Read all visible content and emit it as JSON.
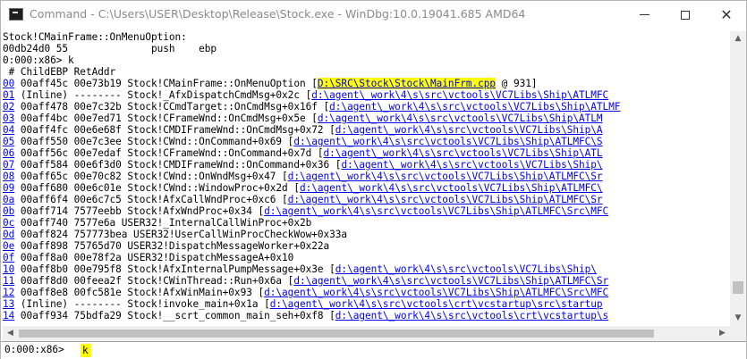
{
  "window": {
    "title": "Command - C:\\Users\\USER\\Desktop\\Release\\Stock.exe - WinDbg:10.0.19041.685 AMD64",
    "minimize_icon": "minimize-icon",
    "maximize_icon": "maximize-icon",
    "close_glyph": "✕"
  },
  "scrollbar": {
    "up": "▲",
    "down": "▼",
    "left": "◀",
    "right": "▶"
  },
  "output": {
    "pre_lines": [
      "Stock!CMainFrame::OnMenuOption:",
      "00db24d0 55              push    ebp",
      "0:000:x86> k",
      " # ChildEBP RetAddr"
    ],
    "frames": [
      {
        "num": "00",
        "ebp": "00aff45c",
        "ret": "00e73b19",
        "func": "Stock!CMainFrame::OnMenuOption",
        "src": "D:\\SRC\\Stock\\Stock\\MainFrm.cpp",
        "tail": " @ 931]"
      },
      {
        "num": "01",
        "ebp": "(Inline)",
        "ret": "--------",
        "func": "Stock!_AfxDispatchCmdMsg+0x2c",
        "src": "d:\\agent\\_work\\4\\s\\src\\vctools\\VC7Libs\\Ship\\ATLMFC",
        "tail": ""
      },
      {
        "num": "02",
        "ebp": "00aff478",
        "ret": "00e7c32b",
        "func": "Stock!CCmdTarget::OnCmdMsg+0x16f",
        "src": "d:\\agent\\_work\\4\\s\\src\\vctools\\VC7Libs\\Ship\\ATLMF",
        "tail": ""
      },
      {
        "num": "03",
        "ebp": "00aff4bc",
        "ret": "00e7ed71",
        "func": "Stock!CFrameWnd::OnCmdMsg+0x5e",
        "src": "d:\\agent\\_work\\4\\s\\src\\vctools\\VC7Libs\\Ship\\ATLM",
        "tail": ""
      },
      {
        "num": "04",
        "ebp": "00aff4fc",
        "ret": "00e6e68f",
        "func": "Stock!CMDIFrameWnd::OnCmdMsg+0x72",
        "src": "d:\\agent\\_work\\4\\s\\src\\vctools\\VC7Libs\\Ship\\A",
        "tail": ""
      },
      {
        "num": "05",
        "ebp": "00aff550",
        "ret": "00e7c3ee",
        "func": "Stock!CWnd::OnCommand+0x69",
        "src": "d:\\agent\\_work\\4\\s\\src\\vctools\\VC7Libs\\Ship\\ATLMFC\\S",
        "tail": ""
      },
      {
        "num": "06",
        "ebp": "00aff56c",
        "ret": "00e7edaf",
        "func": "Stock!CFrameWnd::OnCommand+0x7d",
        "src": "d:\\agent\\_work\\4\\s\\src\\vctools\\VC7Libs\\Ship\\ATL",
        "tail": ""
      },
      {
        "num": "07",
        "ebp": "00aff584",
        "ret": "00e6f3d0",
        "func": "Stock!CMDIFrameWnd::OnCommand+0x36",
        "src": "d:\\agent\\_work\\4\\s\\src\\vctools\\VC7Libs\\Ship\\",
        "tail": ""
      },
      {
        "num": "08",
        "ebp": "00aff65c",
        "ret": "00e70c82",
        "func": "Stock!CWnd::OnWndMsg+0x47",
        "src": "d:\\agent\\_work\\4\\s\\src\\vctools\\VC7Libs\\Ship\\ATLMFC\\Sr",
        "tail": ""
      },
      {
        "num": "09",
        "ebp": "00aff680",
        "ret": "00e6c01e",
        "func": "Stock!CWnd::WindowProc+0x2d",
        "src": "d:\\agent\\_work\\4\\s\\src\\vctools\\VC7Libs\\Ship\\ATLMFC\\",
        "tail": ""
      },
      {
        "num": "0a",
        "ebp": "00aff6f4",
        "ret": "00e6c7c5",
        "func": "Stock!AfxCallWndProc+0xc6",
        "src": "d:\\agent\\_work\\4\\s\\src\\vctools\\VC7Libs\\Ship\\ATLMFC\\Sr",
        "tail": ""
      },
      {
        "num": "0b",
        "ebp": "00aff714",
        "ret": "7577eebb",
        "func": "Stock!AfxWndProc+0x34",
        "src": "d:\\agent\\_work\\4\\s\\src\\vctools\\VC7Libs\\Ship\\ATLMFC\\Src\\MFC",
        "tail": ""
      },
      {
        "num": "0c",
        "ebp": "00aff740",
        "ret": "7577e6a",
        "func": "USER32!_InternalCallWinProc+0x2b",
        "src": "",
        "tail": ""
      },
      {
        "num": "0d",
        "ebp": "00aff824",
        "ret": "757773bea",
        "func": "USER32!UserCallWinProcCheckWow+0x33a",
        "src": "",
        "tail": ""
      },
      {
        "num": "0e",
        "ebp": "00aff898",
        "ret": "75765d70",
        "func": "USER32!DispatchMessageWorker+0x22a",
        "src": "",
        "tail": ""
      },
      {
        "num": "0f",
        "ebp": "00aff8a0",
        "ret": "00e78f2a",
        "func": "USER32!DispatchMessageA+0x10",
        "src": "",
        "tail": ""
      },
      {
        "num": "10",
        "ebp": "00aff8b0",
        "ret": "00e795f8",
        "func": "Stock!AfxInternalPumpMessage+0x3e",
        "src": "d:\\agent\\_work\\4\\s\\src\\vctools\\VC7Libs\\Ship\\",
        "tail": ""
      },
      {
        "num": "11",
        "ebp": "00aff8d0",
        "ret": "00feea2f",
        "func": "Stock!CWinThread::Run+0x6a",
        "src": "d:\\agent\\_work\\4\\s\\src\\vctools\\VC7Libs\\Ship\\ATLMFC\\Sr",
        "tail": ""
      },
      {
        "num": "12",
        "ebp": "00aff8e8",
        "ret": "00fc581e",
        "func": "Stock!AfxWinMain+0x93",
        "src": "d:\\agent\\_work\\4\\s\\src\\vctools\\VC7Libs\\Ship\\ATLMFC\\Src\\MFC",
        "tail": ""
      },
      {
        "num": "13",
        "ebp": "(Inline)",
        "ret": "--------",
        "func": "Stock!invoke_main+0x1a",
        "src": "d:\\agent\\_work\\4\\s\\src\\vctools\\crt\\vcstartup\\src\\startup",
        "tail": ""
      },
      {
        "num": "14",
        "ebp": "00aff934",
        "ret": "75bdfa29",
        "func": "Stock!__scrt_common_main_seh+0xf8",
        "src": "d:\\agent\\_work\\4\\s\\src\\vctools\\crt\\vcstartup\\s",
        "tail": ""
      }
    ]
  },
  "command": {
    "prompt": "0:000:x86>",
    "value": "k",
    "highlight_color": "#ffff00"
  },
  "colors": {
    "link": "#0000ee",
    "highlight": "#ffff00",
    "text": "#000000",
    "title_text": "#8a8a8a"
  }
}
